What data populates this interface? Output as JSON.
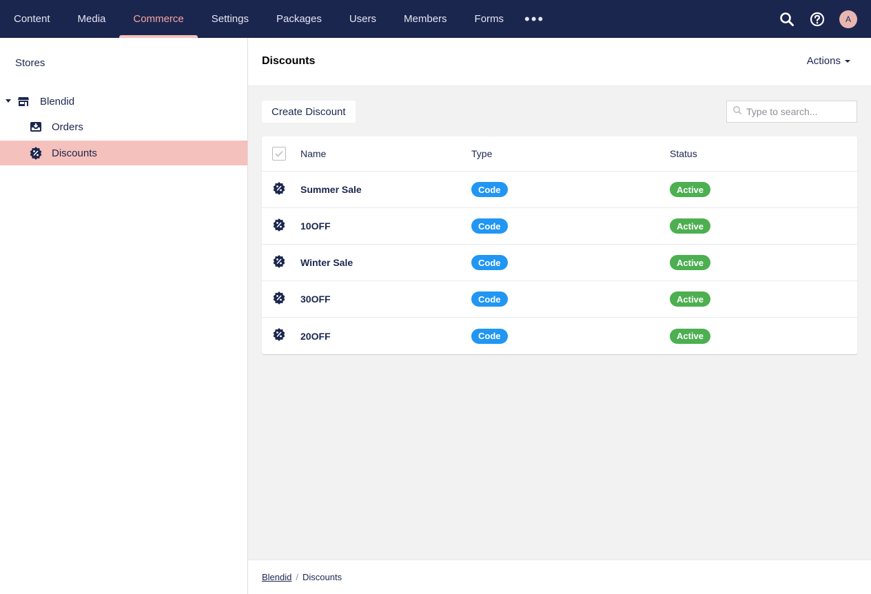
{
  "topnav": {
    "items": [
      {
        "label": "Content",
        "active": false
      },
      {
        "label": "Media",
        "active": false
      },
      {
        "label": "Commerce",
        "active": true
      },
      {
        "label": "Settings",
        "active": false
      },
      {
        "label": "Packages",
        "active": false
      },
      {
        "label": "Users",
        "active": false
      },
      {
        "label": "Members",
        "active": false
      },
      {
        "label": "Forms",
        "active": false
      }
    ],
    "more_label": "•••",
    "avatar_initial": "A"
  },
  "sidebar": {
    "title": "Stores",
    "store": "Blendid",
    "items": [
      {
        "label": "Orders",
        "icon": "inbox-icon"
      },
      {
        "label": "Discounts",
        "icon": "discount-badge-icon",
        "selected": true
      }
    ]
  },
  "main": {
    "title": "Discounts",
    "actions_label": "Actions",
    "create_label": "Create Discount",
    "search_placeholder": "Type to search...",
    "columns": [
      "Name",
      "Type",
      "Status"
    ],
    "rows": [
      {
        "name": "Summer Sale",
        "type": "Code",
        "status": "Active"
      },
      {
        "name": "10OFF",
        "type": "Code",
        "status": "Active"
      },
      {
        "name": "Winter Sale",
        "type": "Code",
        "status": "Active"
      },
      {
        "name": "30OFF",
        "type": "Code",
        "status": "Active"
      },
      {
        "name": "20OFF",
        "type": "Code",
        "status": "Active"
      }
    ]
  },
  "breadcrumb": {
    "items": [
      "Blendid",
      "Discounts"
    ],
    "separator": "/"
  },
  "colors": {
    "topbar": "#1b264f",
    "accent": "#f5c1bc",
    "type_badge": "#2196f3",
    "status_badge": "#4caf50"
  }
}
